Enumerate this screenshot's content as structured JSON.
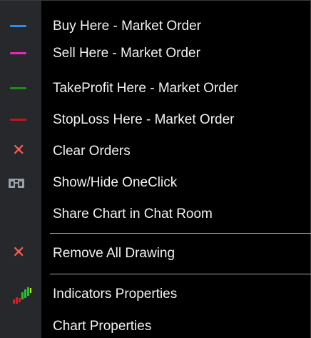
{
  "menu": {
    "items": [
      {
        "label": "Buy Here - Market Order",
        "icon": "blue-line-icon",
        "color": "#2c8fe4"
      },
      {
        "label": "Sell Here - Market Order",
        "icon": "magenta-line-icon",
        "color": "#e628c2"
      },
      {
        "label": "TakeProfit Here - Market Order",
        "icon": "green-line-icon",
        "color": "#1d8f18"
      },
      {
        "label": "StopLoss Here - Market Order",
        "icon": "red-line-icon",
        "color": "#c4151b"
      },
      {
        "label": "Clear Orders",
        "icon": "close-icon",
        "color": "#ff5f56"
      },
      {
        "label": "Show/Hide OneClick",
        "icon": "one-click-panel-icon",
        "color": "#9aa0a8"
      },
      {
        "label": "Share Chart in Chat Room",
        "icon": "",
        "color": ""
      },
      {
        "label": "Remove All Drawing",
        "icon": "close-icon",
        "color": "#ff5f56"
      },
      {
        "label": "Indicators Properties",
        "icon": "indicators-icon",
        "color": "#27c22d"
      },
      {
        "label": "Chart Properties",
        "icon": "",
        "color": ""
      }
    ]
  }
}
